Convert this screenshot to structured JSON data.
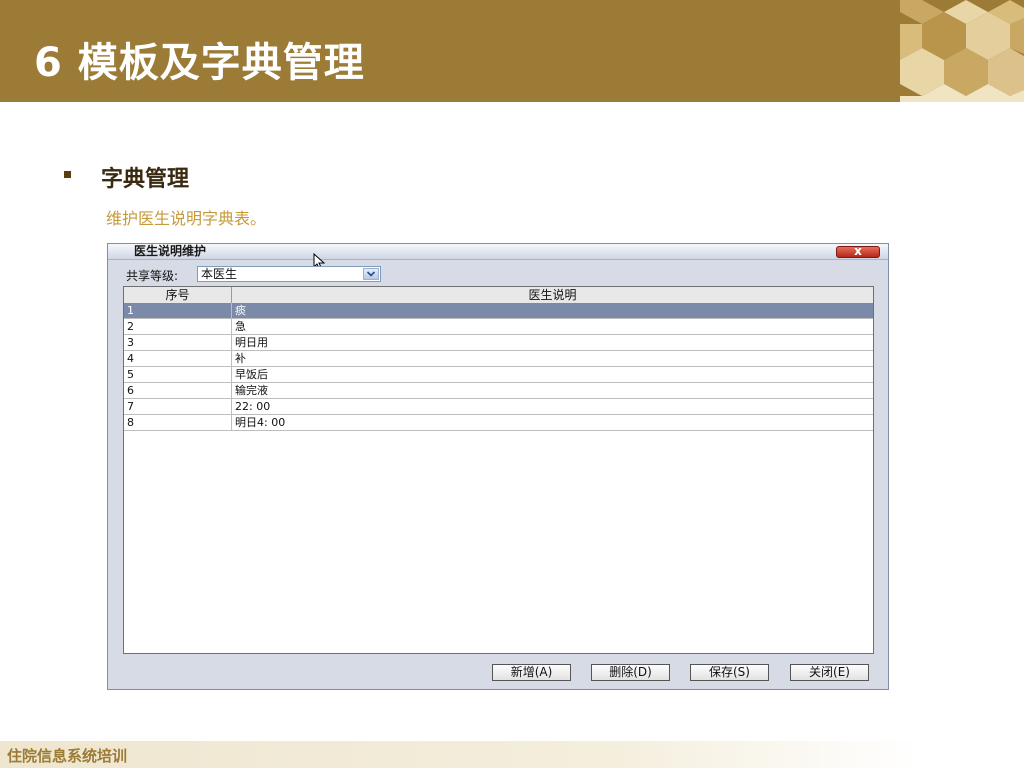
{
  "slide": {
    "title": "6 模板及字典管理",
    "section_title": "字典管理",
    "section_desc": "维护医生说明字典表。",
    "footer": "住院信息系统培训"
  },
  "dialog": {
    "title": "医生说明维护",
    "close_label": "x",
    "share_label": "共享等级:",
    "share_value": "本医生",
    "columns": [
      "序号",
      "医生说明"
    ],
    "rows": [
      {
        "num": "1",
        "text": "痰"
      },
      {
        "num": "2",
        "text": "急"
      },
      {
        "num": "3",
        "text": "明日用"
      },
      {
        "num": "4",
        "text": "补"
      },
      {
        "num": "5",
        "text": "早饭后"
      },
      {
        "num": "6",
        "text": "输完液"
      },
      {
        "num": "7",
        "text": "22: 00"
      },
      {
        "num": "8",
        "text": "明日4: 00"
      }
    ],
    "selected_row": 0,
    "buttons": {
      "add": "新增(A)",
      "delete": "删除(D)",
      "save": "保存(S)",
      "close": "关闭(E)"
    }
  },
  "colors": {
    "header_bg": "#9b7b35",
    "selected_row": "#7b8aa8",
    "accent_text": "#c69a3a"
  }
}
